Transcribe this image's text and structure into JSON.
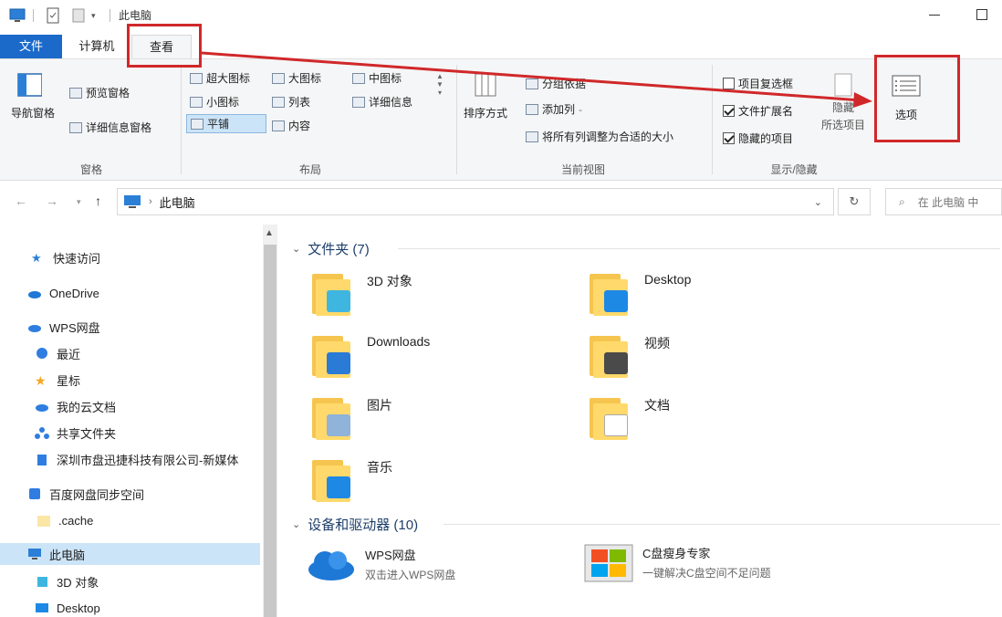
{
  "window": {
    "title": "此电脑"
  },
  "ribbon_tabs": {
    "file": "文件",
    "computer": "计算机",
    "view": "查看"
  },
  "ribbon": {
    "panes": {
      "nav_pane": "导航窗格",
      "preview_pane": "预览窗格",
      "details_pane": "详细信息窗格",
      "group_label": "窗格"
    },
    "layout": {
      "xl_icons": "超大图标",
      "large_icons": "大图标",
      "medium_icons": "中图标",
      "small_icons": "小图标",
      "list": "列表",
      "details": "详细信息",
      "tiles": "平铺",
      "content": "内容",
      "group_label": "布局"
    },
    "current_view": {
      "sort_by": "排序方式",
      "group_by": "分组依据",
      "add_columns": "添加列",
      "fit_columns": "将所有列调整为合适的大小",
      "group_label": "当前视图"
    },
    "show_hide": {
      "item_checkboxes": "项目复选框",
      "file_extensions": "文件扩展名",
      "hidden_items": "隐藏的项目",
      "hide_selected": "隐藏",
      "hide_selected_2": "所选项目",
      "group_label": "显示/隐藏"
    },
    "options": "选项"
  },
  "address_bar": {
    "path": "此电脑",
    "search_placeholder": "在 此电脑 中"
  },
  "nav_pane": {
    "items": [
      {
        "label": "快速访问",
        "icon": "star-icon"
      },
      {
        "label": "OneDrive",
        "icon": "cloud-icon"
      },
      {
        "label": "WPS网盘",
        "icon": "wps-cloud-icon"
      },
      {
        "label": "最近",
        "icon": "clock-icon"
      },
      {
        "label": "星标",
        "icon": "star-icon"
      },
      {
        "label": "我的云文档",
        "icon": "cloud-icon"
      },
      {
        "label": "共享文件夹",
        "icon": "share-icon"
      },
      {
        "label": "深圳市盘迅捷科技有限公司-新媒体",
        "icon": "building-icon"
      },
      {
        "label": "百度网盘同步空间",
        "icon": "baidu-icon"
      },
      {
        "label": ".cache",
        "icon": "folder-icon"
      },
      {
        "label": "此电脑",
        "icon": "computer-icon"
      },
      {
        "label": "3D 对象",
        "icon": "cube-icon"
      },
      {
        "label": "Desktop",
        "icon": "desktop-icon"
      }
    ]
  },
  "content": {
    "folders_header": "文件夹 (7)",
    "folders": [
      {
        "name": "3D 对象",
        "badge": "#3fb6e0"
      },
      {
        "name": "Desktop",
        "badge": "#1e88e5"
      },
      {
        "name": "Downloads",
        "badge": "#2a7bd5"
      },
      {
        "name": "视频",
        "badge": "#4a4a4a"
      },
      {
        "name": "图片",
        "badge": "#8fb3d9"
      },
      {
        "name": "文档",
        "badge": "#ffffff"
      },
      {
        "name": "音乐",
        "badge": "#1e88e5"
      }
    ],
    "devices_header": "设备和驱动器 (10)",
    "devices": [
      {
        "name": "WPS网盘",
        "sub": "双击进入WPS网盘",
        "icon": "wps-cloud-icon"
      },
      {
        "name": "C盘瘦身专家",
        "sub": "一键解决C盘空间不足问题",
        "icon": "windows-logo-icon"
      }
    ]
  },
  "colors": {
    "accent": "#1b6ac9",
    "highlight": "#d0282a",
    "selection": "#cce4f7",
    "folder": "#ffd96b"
  }
}
